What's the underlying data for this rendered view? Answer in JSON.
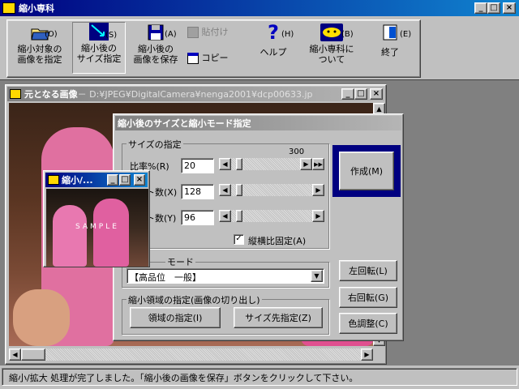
{
  "app": {
    "title": "縮小専科"
  },
  "menu_controls": {
    "minimize": "_",
    "maximize": "□",
    "close": "×"
  },
  "toolbar": {
    "open": {
      "key": "(O)",
      "label1": "縮小対象の",
      "label2": "画像を指定"
    },
    "size": {
      "key": "(S)",
      "label1": "縮小後の",
      "label2": "サイズ指定"
    },
    "save": {
      "key": "(A)",
      "label1": "縮小後の",
      "label2": "画像を保存"
    },
    "paste": {
      "label": "貼付け"
    },
    "copy": {
      "label": "コピー"
    },
    "help": {
      "key": "(H)",
      "label": "ヘルプ"
    },
    "about": {
      "key": "(B)",
      "label1": "縮小専科に",
      "label2": "ついて"
    },
    "exit": {
      "key": "(E)",
      "label": "終了"
    }
  },
  "source_window": {
    "title": "元となる画像",
    "path": " － D:¥JPEG¥DigitalCamera¥nenga2001¥dcp00633.jp"
  },
  "dialog": {
    "title": "縮小後のサイズと縮小モード指定",
    "size_group": "サイズの指定",
    "ratio_label": "比率%(R)",
    "ratio_value": "20",
    "ratio_max": "300",
    "width_label": "ト数(X)",
    "width_value": "128",
    "height_label": "ト数(Y)",
    "height_value": "96",
    "keep_ratio_label": "縦横比固定(A)",
    "mode_group": "モード",
    "mode_value": "【高品位　一般】",
    "crop_group": "縮小領域の指定(画像の切り出し)",
    "region_button": "領域の指定(I)",
    "size_first_button": "サイズ先指定(Z)",
    "create_button": "作成(M)",
    "rotate_left_button": "左回転(L)",
    "rotate_right_button": "右回転(G)",
    "color_adjust_button": "色調整(C)"
  },
  "thumb_window": {
    "title": "縮小/...",
    "watermark": "SAMPLE"
  },
  "status_bar": {
    "text": "縮小/拡大 処理が完了しました。「縮小後の画像を保存」ボタンをクリックして下さい。"
  }
}
